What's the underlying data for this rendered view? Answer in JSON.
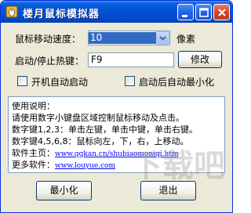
{
  "window": {
    "title": "楼月鼠标模拟器"
  },
  "titlebar_buttons": {
    "minimize_icon": "minimize-icon",
    "maximize_icon": "maximize-icon",
    "close_icon": "close-icon"
  },
  "speed": {
    "label": "鼠标移动速度：",
    "value": "10",
    "unit": "像素"
  },
  "hotkey": {
    "label": "启动/停止热键：",
    "value": "F9",
    "modify_button": "修改"
  },
  "options": {
    "autostart_label": "开机自动启动",
    "minimize_after_start_label": "启动后自动最小化"
  },
  "info": {
    "heading": "使用说明：",
    "line1": "请使用数字小键盘区域控制鼠标移动及点击。",
    "line2": "数字键1,2,3：单击左键，单击中键，单击右键。",
    "line3": "数字键4,5,6,8：鼠标向左，下，右，上移动。",
    "homepage_label": "软件主页：",
    "homepage_url": "www.qqkan.cn/shubiaomoniqi.htm",
    "more_label": "更多软件：",
    "more_url": "www.louyue.com"
  },
  "buttons": {
    "minimize": "最小化",
    "exit": "退出"
  },
  "watermark": {
    "text": "下载吧"
  },
  "colors": {
    "titlebar": "#0352d6",
    "face": "#ece9d8",
    "selection": "#316ac5",
    "link": "#0000ff"
  }
}
